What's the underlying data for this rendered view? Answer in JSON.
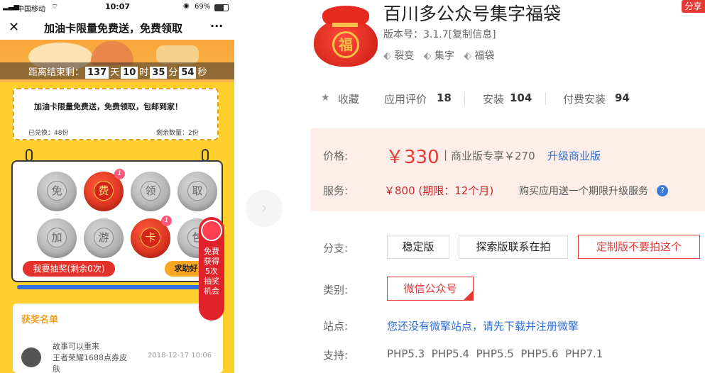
{
  "phone": {
    "status": {
      "carrier": "中国移动",
      "time": "10:07",
      "battery": "69%"
    },
    "nav": {
      "title": "加油卡限量免费送，免费领取",
      "close": "✕",
      "more": "···"
    },
    "countdown": {
      "label": "距离结束剩：",
      "days": "137",
      "d_unit": "天",
      "hours": "10",
      "h_unit": "时",
      "minutes": "35",
      "m_unit": "分",
      "seconds": "54",
      "s_unit": "秒"
    },
    "ticket": {
      "title": "加油卡限量免费送，免费领取，包邮到家！",
      "redeemed": "已兑换：48份",
      "remaining": "剩余数量：2份"
    },
    "bags": [
      "免",
      "费",
      "领",
      "取",
      "加",
      "游",
      "卡",
      "包"
    ],
    "bag_badges": {
      "fei": "1",
      "ka": "1"
    },
    "draw_button": "我要抽奖(剩余0次)",
    "help_button": "求助好",
    "side_promo": "免费获得5次抽奖机会",
    "winners": {
      "title": "获奖名单",
      "entry_line1": "故事可以重来",
      "entry_line2": "王者荣耀1688点券皮",
      "entry_line3": "肤",
      "entry_time": "2018-12-17 10:06"
    }
  },
  "app": {
    "title": "百川多公众号集字福袋",
    "share": "分享",
    "logo_char": "福",
    "version": "版本号：3.1.7[复制信息]",
    "tags": [
      "裂变",
      "集字",
      "福袋"
    ],
    "stats": {
      "favorite": "收藏",
      "rating_label": "应用评价",
      "rating": "18",
      "install_label": "安装",
      "install": "104",
      "paid_label": "付费安装",
      "paid": "94"
    },
    "price": {
      "label": "价格:",
      "value": "￥330",
      "sep": "|",
      "biz_text": "商业版专享￥270",
      "upgrade": "升级商业版"
    },
    "service": {
      "label": "服务:",
      "value": "￥800 (期限：12个月)",
      "note": "购买应用送一个期限升级服务"
    },
    "branch": {
      "label": "分支:",
      "options": [
        "稳定版",
        "探索版联系在拍",
        "定制版不要拍这个"
      ]
    },
    "category": {
      "label": "类别:",
      "value": "微信公众号"
    },
    "site": {
      "label": "站点:",
      "link": "您还没有微擎站点，请先下载并注册微擎"
    },
    "support": {
      "label": "支持:",
      "values": [
        "PHP5.3",
        "PHP5.4",
        "PHP5.5",
        "PHP5.6",
        "PHP7.1"
      ]
    }
  },
  "colors": {
    "accent_red": "#e53935",
    "link_blue": "#2e6fd6",
    "phone_yellow": "#ffcf2e"
  }
}
